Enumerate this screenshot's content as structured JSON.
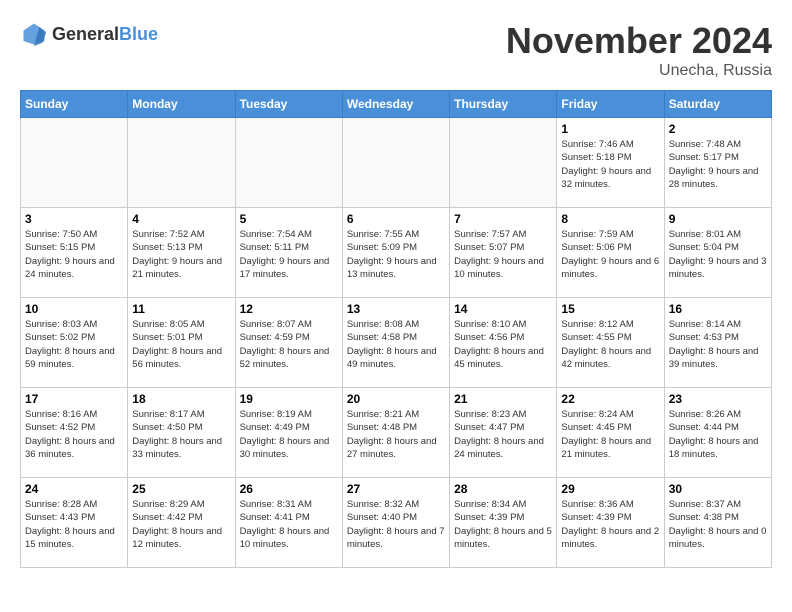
{
  "header": {
    "logo_general": "General",
    "logo_blue": "Blue",
    "month_title": "November 2024",
    "location": "Unecha, Russia"
  },
  "days_of_week": [
    "Sunday",
    "Monday",
    "Tuesday",
    "Wednesday",
    "Thursday",
    "Friday",
    "Saturday"
  ],
  "weeks": [
    [
      {
        "day": "",
        "text": ""
      },
      {
        "day": "",
        "text": ""
      },
      {
        "day": "",
        "text": ""
      },
      {
        "day": "",
        "text": ""
      },
      {
        "day": "",
        "text": ""
      },
      {
        "day": "1",
        "text": "Sunrise: 7:46 AM\nSunset: 5:18 PM\nDaylight: 9 hours and 32 minutes."
      },
      {
        "day": "2",
        "text": "Sunrise: 7:48 AM\nSunset: 5:17 PM\nDaylight: 9 hours and 28 minutes."
      }
    ],
    [
      {
        "day": "3",
        "text": "Sunrise: 7:50 AM\nSunset: 5:15 PM\nDaylight: 9 hours and 24 minutes."
      },
      {
        "day": "4",
        "text": "Sunrise: 7:52 AM\nSunset: 5:13 PM\nDaylight: 9 hours and 21 minutes."
      },
      {
        "day": "5",
        "text": "Sunrise: 7:54 AM\nSunset: 5:11 PM\nDaylight: 9 hours and 17 minutes."
      },
      {
        "day": "6",
        "text": "Sunrise: 7:55 AM\nSunset: 5:09 PM\nDaylight: 9 hours and 13 minutes."
      },
      {
        "day": "7",
        "text": "Sunrise: 7:57 AM\nSunset: 5:07 PM\nDaylight: 9 hours and 10 minutes."
      },
      {
        "day": "8",
        "text": "Sunrise: 7:59 AM\nSunset: 5:06 PM\nDaylight: 9 hours and 6 minutes."
      },
      {
        "day": "9",
        "text": "Sunrise: 8:01 AM\nSunset: 5:04 PM\nDaylight: 9 hours and 3 minutes."
      }
    ],
    [
      {
        "day": "10",
        "text": "Sunrise: 8:03 AM\nSunset: 5:02 PM\nDaylight: 8 hours and 59 minutes."
      },
      {
        "day": "11",
        "text": "Sunrise: 8:05 AM\nSunset: 5:01 PM\nDaylight: 8 hours and 56 minutes."
      },
      {
        "day": "12",
        "text": "Sunrise: 8:07 AM\nSunset: 4:59 PM\nDaylight: 8 hours and 52 minutes."
      },
      {
        "day": "13",
        "text": "Sunrise: 8:08 AM\nSunset: 4:58 PM\nDaylight: 8 hours and 49 minutes."
      },
      {
        "day": "14",
        "text": "Sunrise: 8:10 AM\nSunset: 4:56 PM\nDaylight: 8 hours and 45 minutes."
      },
      {
        "day": "15",
        "text": "Sunrise: 8:12 AM\nSunset: 4:55 PM\nDaylight: 8 hours and 42 minutes."
      },
      {
        "day": "16",
        "text": "Sunrise: 8:14 AM\nSunset: 4:53 PM\nDaylight: 8 hours and 39 minutes."
      }
    ],
    [
      {
        "day": "17",
        "text": "Sunrise: 8:16 AM\nSunset: 4:52 PM\nDaylight: 8 hours and 36 minutes."
      },
      {
        "day": "18",
        "text": "Sunrise: 8:17 AM\nSunset: 4:50 PM\nDaylight: 8 hours and 33 minutes."
      },
      {
        "day": "19",
        "text": "Sunrise: 8:19 AM\nSunset: 4:49 PM\nDaylight: 8 hours and 30 minutes."
      },
      {
        "day": "20",
        "text": "Sunrise: 8:21 AM\nSunset: 4:48 PM\nDaylight: 8 hours and 27 minutes."
      },
      {
        "day": "21",
        "text": "Sunrise: 8:23 AM\nSunset: 4:47 PM\nDaylight: 8 hours and 24 minutes."
      },
      {
        "day": "22",
        "text": "Sunrise: 8:24 AM\nSunset: 4:45 PM\nDaylight: 8 hours and 21 minutes."
      },
      {
        "day": "23",
        "text": "Sunrise: 8:26 AM\nSunset: 4:44 PM\nDaylight: 8 hours and 18 minutes."
      }
    ],
    [
      {
        "day": "24",
        "text": "Sunrise: 8:28 AM\nSunset: 4:43 PM\nDaylight: 8 hours and 15 minutes."
      },
      {
        "day": "25",
        "text": "Sunrise: 8:29 AM\nSunset: 4:42 PM\nDaylight: 8 hours and 12 minutes."
      },
      {
        "day": "26",
        "text": "Sunrise: 8:31 AM\nSunset: 4:41 PM\nDaylight: 8 hours and 10 minutes."
      },
      {
        "day": "27",
        "text": "Sunrise: 8:32 AM\nSunset: 4:40 PM\nDaylight: 8 hours and 7 minutes."
      },
      {
        "day": "28",
        "text": "Sunrise: 8:34 AM\nSunset: 4:39 PM\nDaylight: 8 hours and 5 minutes."
      },
      {
        "day": "29",
        "text": "Sunrise: 8:36 AM\nSunset: 4:39 PM\nDaylight: 8 hours and 2 minutes."
      },
      {
        "day": "30",
        "text": "Sunrise: 8:37 AM\nSunset: 4:38 PM\nDaylight: 8 hours and 0 minutes."
      }
    ]
  ]
}
